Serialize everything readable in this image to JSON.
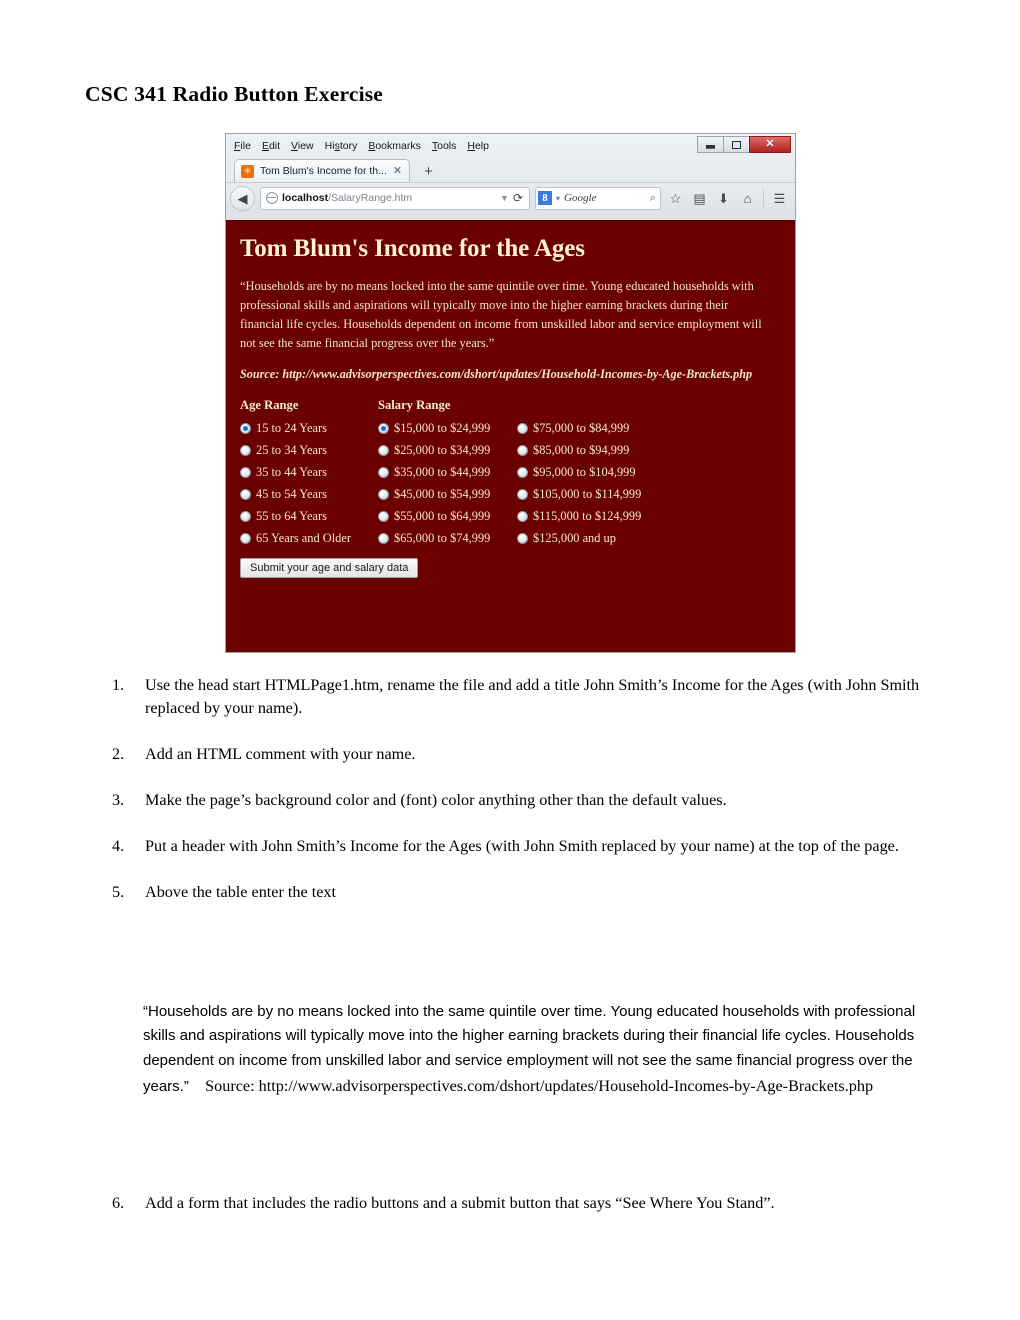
{
  "document": {
    "title": "CSC 341 Radio Button Exercise"
  },
  "browser": {
    "menu_items": [
      {
        "pre": "",
        "key": "F",
        "post": "ile"
      },
      {
        "pre": "",
        "key": "E",
        "post": "dit"
      },
      {
        "pre": "",
        "key": "V",
        "post": "iew"
      },
      {
        "pre": "Hi",
        "key": "s",
        "post": "tory"
      },
      {
        "pre": "",
        "key": "B",
        "post": "ookmarks"
      },
      {
        "pre": "",
        "key": "T",
        "post": "ools"
      },
      {
        "pre": "",
        "key": "H",
        "post": "elp"
      }
    ],
    "window_controls": {
      "minimize": "minimize-icon",
      "restore": "restore-icon",
      "close": "✕"
    },
    "tab": {
      "favicon": "page-favicon",
      "label": "Tom Blum's Income for th...",
      "close": "✕"
    },
    "new_tab": "+",
    "nav": {
      "back": "◀",
      "url_host": "localhost",
      "url_path": "/SalaryRange.htm",
      "url_dropdown": "▼",
      "reload": "⟳",
      "search_engine": "8",
      "search_caret": "▾",
      "search_placeholder": "Google",
      "search_magnifier": "⌕",
      "toolbar_icons": [
        "☆",
        "▤",
        "⬇",
        "⌂",
        "☰"
      ]
    }
  },
  "webpage": {
    "background_color": "#6b0000",
    "text_color": "#f5e8c6",
    "heading": "Tom Blum's Income for the Ages",
    "quote": "“Households are by no means locked into the same quintile over time. Young educated households with professional skills and aspirations will typically move into the higher earning brackets during their financial life cycles. Households dependent on income from unskilled labor and service employment will not see the same financial progress over the years.”",
    "source": "Source: http://www.advisorperspectives.com/dshort/updates/Household-Incomes-by-Age-Brackets.php",
    "age_column_header": "Age Range",
    "salary_column_header": "Salary Range",
    "age_options": [
      {
        "label": "15 to 24 Years",
        "selected": true
      },
      {
        "label": "25 to 34 Years",
        "selected": false
      },
      {
        "label": "35 to 44 Years",
        "selected": false
      },
      {
        "label": "45 to 54 Years",
        "selected": false
      },
      {
        "label": "55 to 64 Years",
        "selected": false
      },
      {
        "label": "65 Years and Older",
        "selected": false
      }
    ],
    "salary_options_left": [
      {
        "label": "$15,000 to $24,999",
        "selected": true
      },
      {
        "label": "$25,000 to $34,999",
        "selected": false
      },
      {
        "label": "$35,000 to $44,999",
        "selected": false
      },
      {
        "label": "$45,000 to $54,999",
        "selected": false
      },
      {
        "label": "$55,000 to $64,999",
        "selected": false
      },
      {
        "label": "$65,000 to $74,999",
        "selected": false
      }
    ],
    "salary_options_right": [
      {
        "label": "$75,000 to $84,999",
        "selected": false
      },
      {
        "label": "$85,000 to $94,999",
        "selected": false
      },
      {
        "label": "$95,000 to $104,999",
        "selected": false
      },
      {
        "label": "$105,000 to $114,999",
        "selected": false
      },
      {
        "label": "$115,000 to $124,999",
        "selected": false
      },
      {
        "label": "$125,000 and up",
        "selected": false
      }
    ],
    "submit_label": "Submit your age and salary data"
  },
  "instructions": [
    {
      "num": "1.",
      "text": "Use the head start HTMLPage1.htm, rename the file and add a title John Smith’s Income for the Ages (with John Smith replaced by your name)."
    },
    {
      "num": "2.",
      "text": "Add an HTML comment with your name."
    },
    {
      "num": "3.",
      "text": "Make the page’s background color and (font) color anything other than the default values."
    },
    {
      "num": "4.",
      "text": "Put a header with John Smith’s Income for the Ages (with John Smith replaced by your name) at the top of the page."
    },
    {
      "num": "5.",
      "text": "Above the table enter the text"
    }
  ],
  "quote_block": {
    "quote": "“Households are by no means locked into the same quintile over time. Young educated households with professional skills and aspirations will typically move into the higher earning brackets during their financial life cycles. Households dependent on income from unskilled labor and service employment will not see the same financial progress over the years.”",
    "source_label": "Source:",
    "source_url": "http://www.advisorperspectives.com/dshort/updates/Household-Incomes-by-Age-Brackets.php"
  },
  "last_instruction": {
    "num": "6.",
    "text": "Add a form that includes the radio buttons and a submit button that says “See Where You Stand”."
  }
}
